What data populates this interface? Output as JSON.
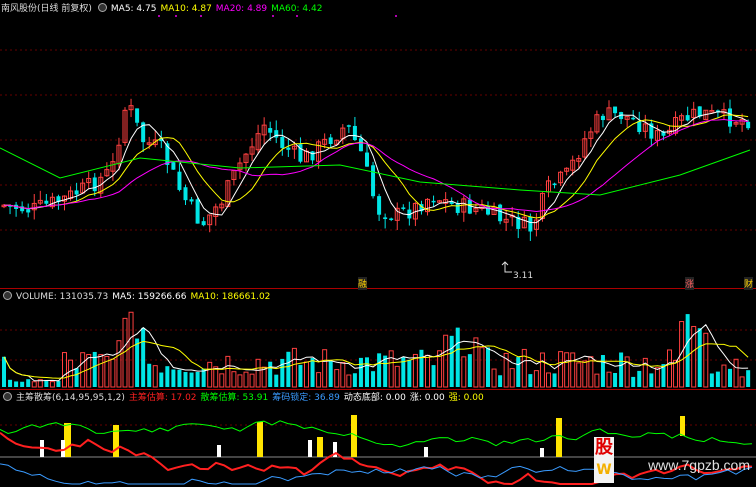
{
  "header": {
    "stock_name": "南风股份(日线 前复权)",
    "indicators": [
      {
        "label": "MA5: 4.75",
        "color": "#ffffff"
      },
      {
        "label": "MA10: 4.87",
        "color": "#ffff00"
      },
      {
        "label": "MA20: 4.89",
        "color": "#ff00ff"
      },
      {
        "label": "MA60: 4.42",
        "color": "#00ff00"
      }
    ]
  },
  "volume_header": {
    "title": "VOLUME: 131035.73",
    "indicators": [
      {
        "label": "MA5: 159266.66",
        "color": "#ffffff"
      },
      {
        "label": "MA10: 186661.02",
        "color": "#ffff00"
      }
    ]
  },
  "chip_header": {
    "title": "主筹散筹(6,14,95,95,1,2)",
    "indicators": [
      {
        "label": "主筹估算: 17.02",
        "color": "#ff2020"
      },
      {
        "label": "散筹估算: 53.91",
        "color": "#00ff00"
      },
      {
        "label": "筹码锁定: 36.89",
        "color": "#3a9bff"
      },
      {
        "label": "动态底部: 0.00",
        "color": "#ffffff"
      },
      {
        "label": "涨: 0.00",
        "color": "#ffffff"
      },
      {
        "label": "强: 0.00",
        "color": "#ffff00"
      }
    ]
  },
  "annotations": {
    "date_marker": "3.11",
    "tag_left": "融",
    "tag_mid": "涨",
    "tag_right": "财"
  },
  "watermark": "www.7gpzb.com",
  "logo": {
    "char1": "股",
    "char2": "W"
  },
  "chart_data": [
    {
      "type": "candlestick",
      "series": [
        {
          "name": "MA5",
          "color": "#ffffff"
        },
        {
          "name": "MA10",
          "color": "#ffff00"
        },
        {
          "name": "MA20",
          "color": "#ff00ff"
        },
        {
          "name": "MA60",
          "color": "#00ff00"
        }
      ],
      "colors": {
        "up": "#ff4040",
        "down": "#00e5e5"
      }
    },
    {
      "type": "bar",
      "series": [
        {
          "name": "MA5",
          "color": "#ffffff"
        },
        {
          "name": "MA10",
          "color": "#ffff00"
        }
      ]
    },
    {
      "type": "line",
      "series": [
        {
          "name": "主筹估算",
          "color": "#ff2020"
        },
        {
          "name": "散筹估算",
          "color": "#00ff00"
        },
        {
          "name": "筹码锁定",
          "color": "#3a9bff"
        }
      ]
    }
  ]
}
